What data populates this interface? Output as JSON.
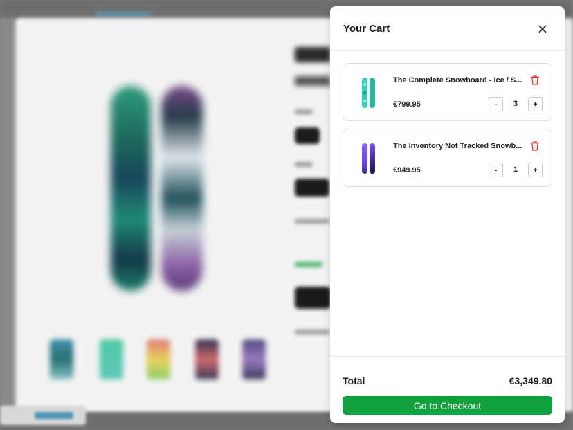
{
  "cart": {
    "title": "Your Cart",
    "close_icon": "close-icon",
    "items": [
      {
        "name": "The Complete Snowboard - Ice / S...",
        "price": "€799.95",
        "quantity": "3",
        "minus_label": "-",
        "plus_label": "+",
        "thumbnail_colors": [
          "#36d1b4",
          "#2bb89e"
        ],
        "delete_icon": "trash-icon"
      },
      {
        "name": "The Inventory Not Tracked Snowb...",
        "price": "€949.95",
        "quantity": "1",
        "minus_label": "-",
        "plus_label": "+",
        "thumbnail_colors": [
          "#7a4ef0",
          "#2b1f5c"
        ],
        "delete_icon": "trash-icon"
      }
    ],
    "total_label": "Total",
    "total_value": "€3,349.80",
    "checkout_label": "Go to Checkout"
  },
  "colors": {
    "checkout": "#11a23d",
    "delete": "#d03a3a",
    "overlay": "#7c7c7c"
  }
}
